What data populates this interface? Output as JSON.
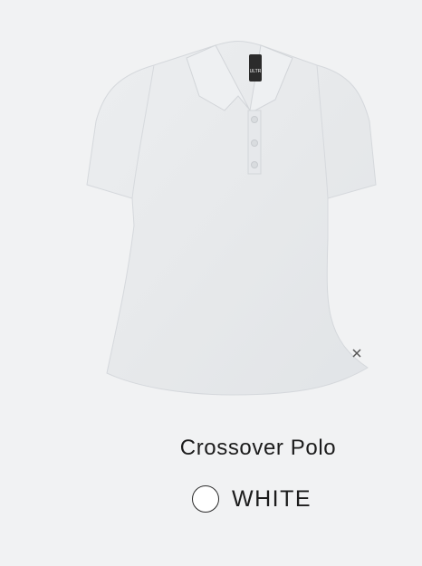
{
  "product": {
    "image_alt": "Crossover Polo in White",
    "logo_text": "ULTR",
    "name": "Crossover Polo",
    "colors": {
      "background": "#f1f2f3",
      "shirt": "#e9ebed",
      "shirt_shadow": "#dadde0",
      "swatch": "#ffffff"
    }
  },
  "swatch": {
    "label": "WHITE"
  }
}
